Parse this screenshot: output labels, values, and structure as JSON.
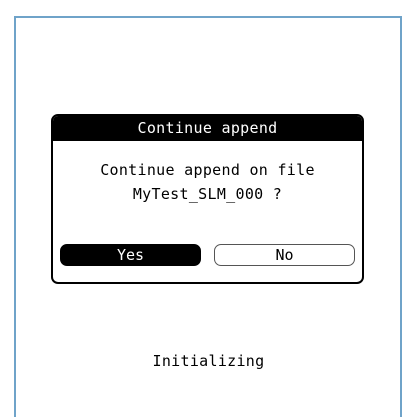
{
  "dialog": {
    "title": "Continue append",
    "message_line1": "Continue append on file",
    "message_line2": "MyTest_SLM_000 ?",
    "yes_label": "Yes",
    "no_label": "No"
  },
  "status": {
    "text": "Initializing"
  },
  "colors": {
    "screen_border": "#6fa3c9",
    "dialog_title_bg": "#000000",
    "selected_button_bg": "#000000"
  }
}
